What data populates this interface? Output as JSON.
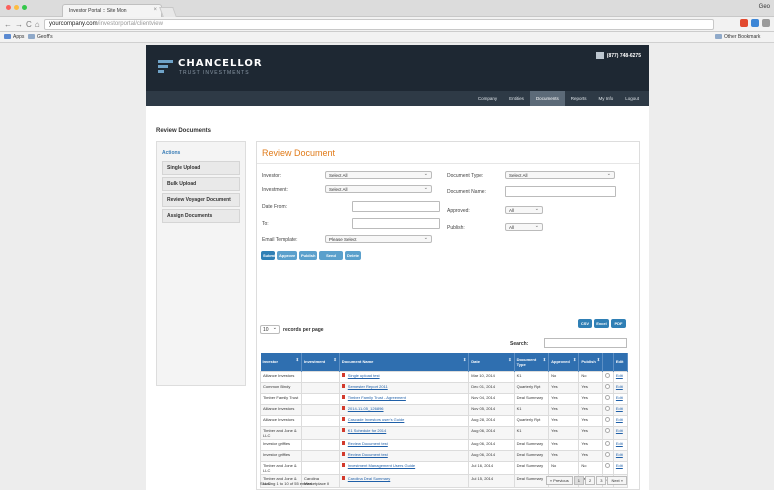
{
  "browser": {
    "tab_title": "Investor Portal :: Site Mon",
    "user": "Geo",
    "url_host": "yourcompany.com",
    "url_path": "/investorportal/clientview",
    "bookmarks_apps": "Apps",
    "bookmark_folder": "Geoff's",
    "other_bookmarks": "Other Bookmark"
  },
  "site": {
    "logo_title": "CHANCELLOR",
    "logo_subtitle": "TRUST INVESTMENTS",
    "phone": "(877) 748-6275",
    "nav": [
      "Company",
      "Entities",
      "Documents",
      "Reports",
      "My Info",
      "Logout"
    ],
    "active_nav": "Documents",
    "page_title": "Review Documents"
  },
  "sidebar": {
    "title": "Actions",
    "items": [
      "Single Upload",
      "Bulk Upload",
      "Review Voyager Document",
      "Assign Documents"
    ]
  },
  "form": {
    "heading": "Review Document",
    "investor_label": "Investor:",
    "investor_value": "Select All",
    "investment_label": "Investment:",
    "investment_value": "Select All",
    "date_from_label": "Date From:",
    "to_label": "To:",
    "email_label": "Email Template:",
    "email_value": "Please Select",
    "doc_type_label": "Document Type:",
    "doc_type_value": "Select All",
    "doc_name_label": "Document Name:",
    "approved_label": "Approved:",
    "approved_value": "All",
    "publish_label": "Publish:",
    "publish_value": "All",
    "buttons": [
      "Submit",
      "Approve",
      "Publish",
      "Send Email",
      "Delete"
    ],
    "export_buttons": [
      "CSV",
      "Excel",
      "PDF"
    ]
  },
  "table": {
    "rpp_value": "10",
    "rpp_label": "records per page",
    "search_label": "Search:",
    "columns": [
      "Investor",
      "Investment",
      "Document Name",
      "Date",
      "Document Type",
      "Approved",
      "Publish",
      "",
      "Edit"
    ],
    "rows": [
      {
        "investor": "Alliance Investors",
        "investment": "",
        "doc": "Single upload test",
        "date": "Mar 10, 2014",
        "type": "K1",
        "approved": "No",
        "publish": "No",
        "edit": "Edit"
      },
      {
        "investor": "Common Bindy",
        "investment": "",
        "doc": "Semester Report 2011",
        "date": "Dec 01, 2014",
        "type": "Quarterly Rpt",
        "approved": "Yes",
        "publish": "Yes",
        "edit": "Edit"
      },
      {
        "investor": "Timber Family Trust",
        "investment": "",
        "doc": "Timber Family Trust - Agreement",
        "date": "Nov 04, 2014",
        "type": "Deal Summary",
        "approved": "Yes",
        "publish": "Yes",
        "edit": "Edit"
      },
      {
        "investor": "Alliance Investors",
        "investment": "",
        "doc": "2014-11-05_126896",
        "date": "Nov 05, 2014",
        "type": "K1",
        "approved": "Yes",
        "publish": "Yes",
        "edit": "Edit"
      },
      {
        "investor": "Alliance Investors",
        "investment": "",
        "doc": "Cascade Investors user's Guide",
        "date": "Aug 28, 2014",
        "type": "Quarterly Rpt",
        "approved": "Yes",
        "publish": "Yes",
        "edit": "Edit"
      },
      {
        "investor": "Timber and Jone & LLC",
        "investment": "",
        "doc": "K1 Schedule for 2014",
        "date": "Aug 06, 2014",
        "type": "K1",
        "approved": "Yes",
        "publish": "Yes",
        "edit": "Edit"
      },
      {
        "investor": "Investor griffies",
        "investment": "",
        "doc": "Review Document test",
        "date": "Aug 06, 2014",
        "type": "Deal Summary",
        "approved": "Yes",
        "publish": "Yes",
        "edit": "Edit"
      },
      {
        "investor": "Investor griffies",
        "investment": "",
        "doc": "Review Document test",
        "date": "Aug 06, 2014",
        "type": "Deal Summary",
        "approved": "Yes",
        "publish": "Yes",
        "edit": "Edit"
      },
      {
        "investor": "Timber and Jone & LLC",
        "investment": "",
        "doc": "Investment Management Users Guide",
        "date": "Jul 16, 2014",
        "type": "Deal Summary",
        "approved": "No",
        "publish": "No",
        "edit": "Edit"
      },
      {
        "investor": "Timber and Jone & LLC",
        "investment": "Carolina Marketplace II",
        "doc": "Carolina Deal Summary",
        "date": "Jul 15, 2014",
        "type": "Deal Summary",
        "approved": "Yes",
        "publish": "Yes",
        "edit": "Edit"
      }
    ],
    "info": "Showing 1 to 10 of 55 entries",
    "pager": [
      "« Previous",
      "1",
      "2",
      "3",
      "Next »"
    ]
  }
}
